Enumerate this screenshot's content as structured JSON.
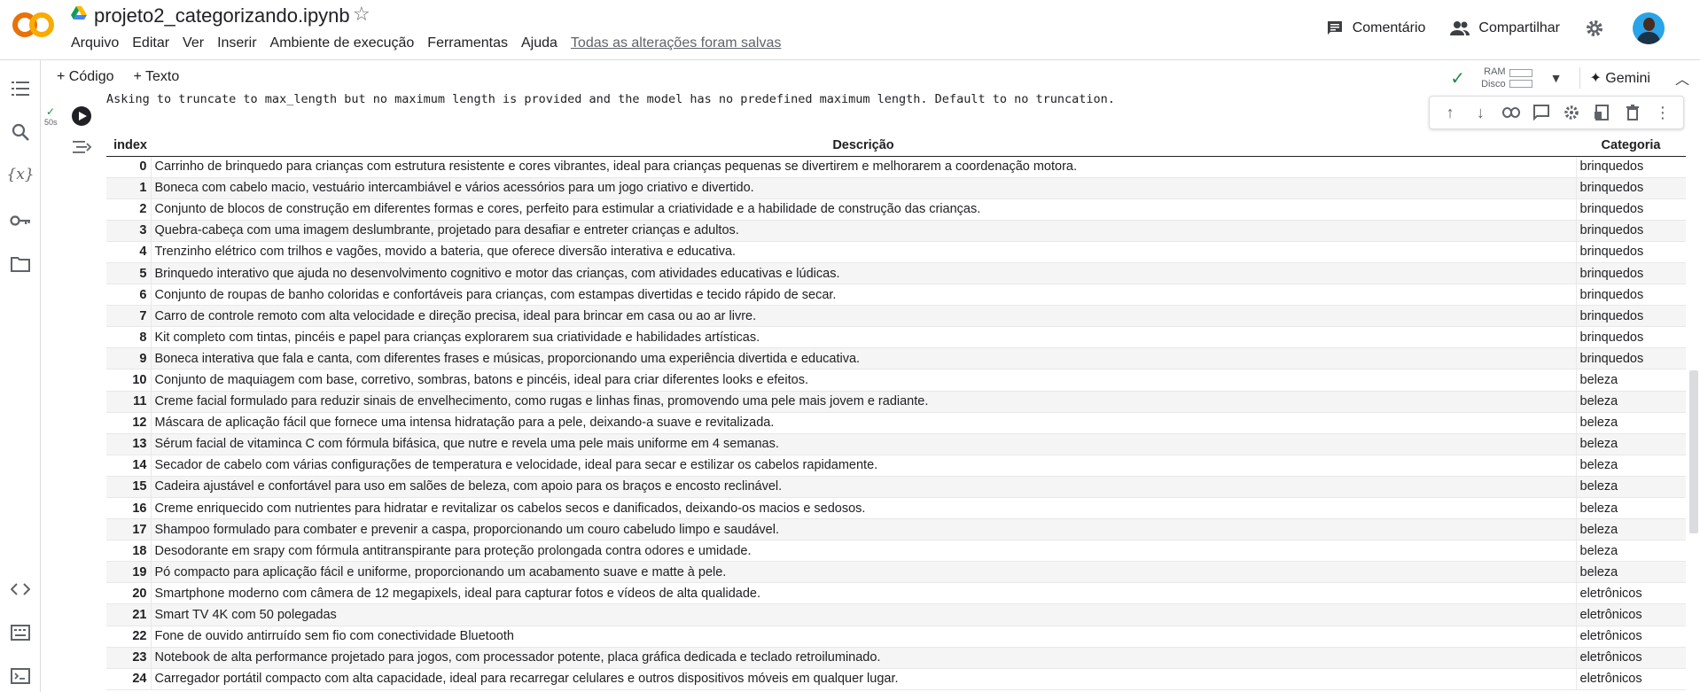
{
  "app": {
    "logo_text": "CO",
    "notebook_title": "projeto2_categorizando.ipynb"
  },
  "menu": [
    "Arquivo",
    "Editar",
    "Ver",
    "Inserir",
    "Ambiente de execução",
    "Ferramentas",
    "Ajuda"
  ],
  "menu_saved": "Todas as alterações foram salvas",
  "header_actions": {
    "comment": "Comentário",
    "share": "Compartilhar"
  },
  "toolbar": {
    "add_code": "+ Código",
    "add_text": "+ Texto",
    "ram": "RAM",
    "disk": "Disco",
    "gemini": "Gemini"
  },
  "cell": {
    "exec_time": "50s",
    "warning": "Asking to truncate to max_length but no maximum length is provided and the model has no predefined maximum length. Default to no truncation."
  },
  "table": {
    "headers": [
      "index",
      "Descrição",
      "Categoria"
    ],
    "rows": [
      [
        "0",
        "Carrinho de brinquedo para crianças com estrutura resistente e cores vibrantes, ideal para crianças pequenas se divertirem e melhorarem a coordenação motora.",
        "brinquedos"
      ],
      [
        "1",
        "Boneca com cabelo macio, vestuário intercambiável e vários acessórios para um jogo criativo e divertido.",
        "brinquedos"
      ],
      [
        "2",
        "Conjunto de blocos de construção em diferentes formas e cores, perfeito para estimular a criatividade e a habilidade de construção das crianças.",
        "brinquedos"
      ],
      [
        "3",
        "Quebra-cabeça com uma imagem deslumbrante, projetado para desafiar e entreter crianças e adultos.",
        "brinquedos"
      ],
      [
        "4",
        "Trenzinho elétrico com trilhos e vagões, movido a bateria, que oferece diversão interativa e educativa.",
        "brinquedos"
      ],
      [
        "5",
        "Brinquedo interativo que ajuda no desenvolvimento cognitivo e motor das crianças, com atividades educativas e lúdicas.",
        "brinquedos"
      ],
      [
        "6",
        "Conjunto de roupas de banho coloridas e confortáveis para crianças, com estampas divertidas e tecido rápido de secar.",
        "brinquedos"
      ],
      [
        "7",
        "Carro de controle remoto com alta velocidade e direção precisa, ideal para brincar em casa ou ao ar livre.",
        "brinquedos"
      ],
      [
        "8",
        "Kit completo com tintas, pincéis e papel para crianças explorarem sua criatividade e habilidades artísticas.",
        "brinquedos"
      ],
      [
        "9",
        "Boneca interativa que fala e canta, com diferentes frases e músicas, proporcionando uma experiência divertida e educativa.",
        "brinquedos"
      ],
      [
        "10",
        "Conjunto de maquiagem com base, corretivo, sombras, batons e pincéis, ideal para criar diferentes looks e efeitos.",
        "beleza"
      ],
      [
        "11",
        "Creme facial formulado para reduzir sinais de envelhecimento, como rugas e linhas finas, promovendo uma pele mais jovem e radiante.",
        "beleza"
      ],
      [
        "12",
        "Máscara de aplicação fácil que fornece uma intensa hidratação para a pele, deixando-a suave e revitalizada.",
        "beleza"
      ],
      [
        "13",
        "Sérum facial de vitaminca C com fórmula bifásica, que nutre e revela uma pele mais uniforme em 4 semanas.",
        "beleza"
      ],
      [
        "14",
        "Secador de cabelo com várias configurações de temperatura e velocidade, ideal para secar e estilizar os cabelos rapidamente.",
        "beleza"
      ],
      [
        "15",
        "Cadeira ajustável e confortável para uso em salões de beleza, com apoio para os braços e encosto reclinável.",
        "beleza"
      ],
      [
        "16",
        "Creme enriquecido com nutrientes para hidratar e revitalizar os cabelos secos e danificados, deixando-os macios e sedosos.",
        "beleza"
      ],
      [
        "17",
        "Shampoo formulado para combater e prevenir a caspa, proporcionando um couro cabeludo limpo e saudável.",
        "beleza"
      ],
      [
        "18",
        "Desodorante em srapy com fórmula antitranspirante para proteção prolongada contra odores e umidade.",
        "beleza"
      ],
      [
        "19",
        "Pó compacto para aplicação fácil e uniforme, proporcionando um acabamento suave e matte à pele.",
        "beleza"
      ],
      [
        "20",
        "Smartphone moderno com câmera de 12 megapixels, ideal para capturar fotos e vídeos de alta qualidade.",
        "eletrônicos"
      ],
      [
        "21",
        "Smart TV 4K com 50 polegadas",
        "eletrônicos"
      ],
      [
        "22",
        "Fone de ouvido antirruído sem fio com conectividade Bluetooth",
        "eletrônicos"
      ],
      [
        "23",
        "Notebook de alta performance projetado para jogos, com processador potente, placa gráfica dedicada e teclado retroiluminado.",
        "eletrônicos"
      ],
      [
        "24",
        "Carregador portátil compacto com alta capacidade, ideal para recarregar celulares e outros dispositivos móveis em qualquer lugar.",
        "eletrônicos"
      ]
    ]
  },
  "colors": {
    "logo_orange": "#f9ab00",
    "accent_green": "#1e8e3e"
  }
}
